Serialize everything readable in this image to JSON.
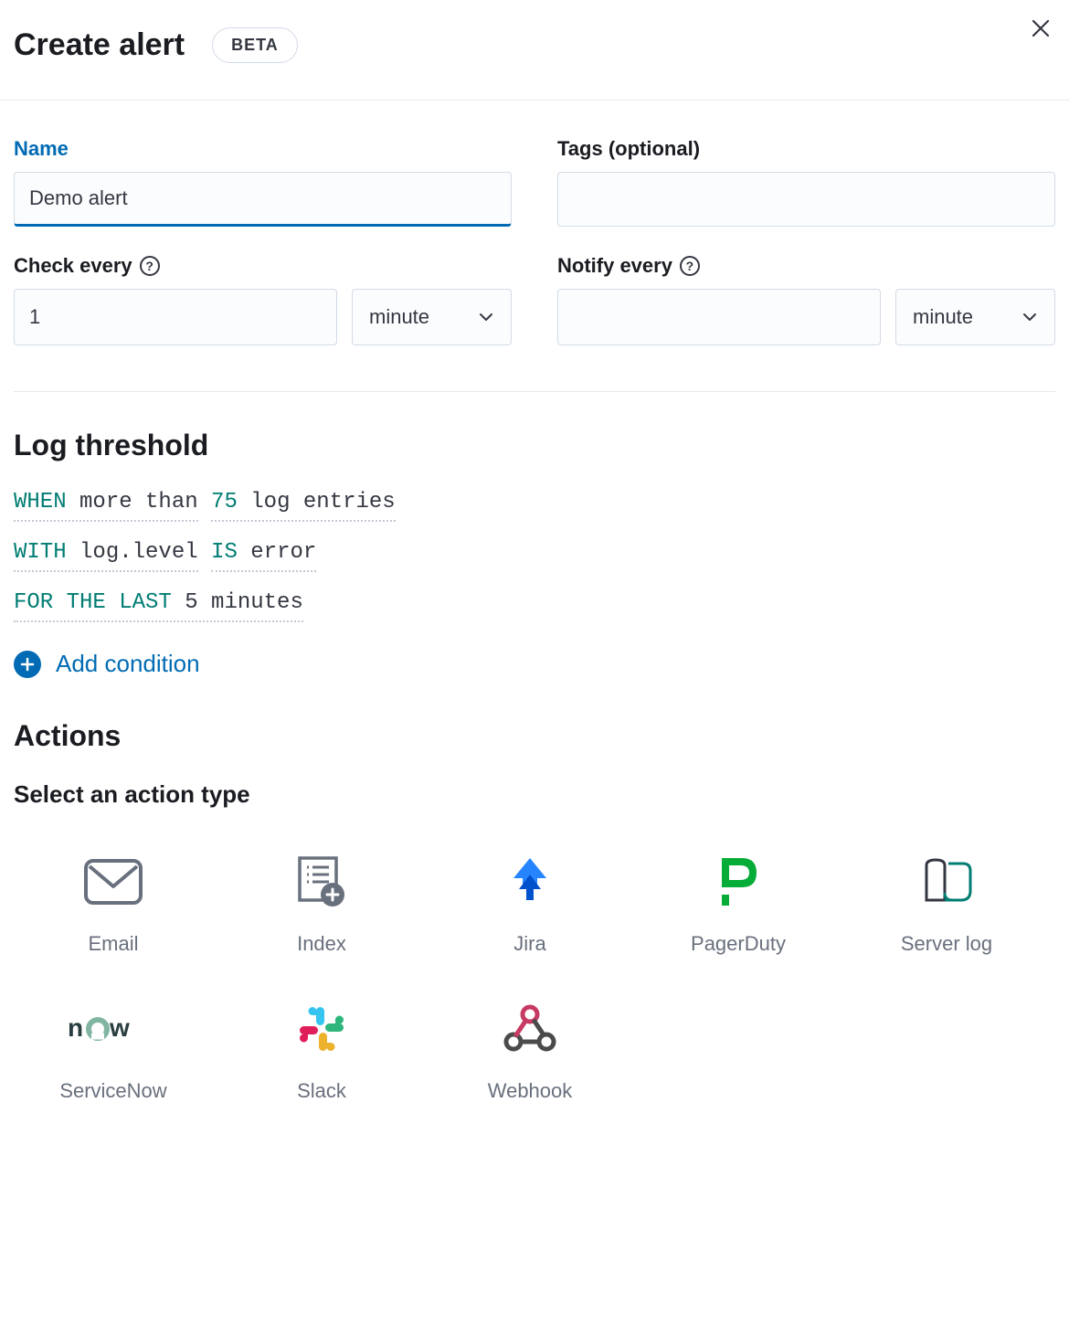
{
  "header": {
    "title": "Create alert",
    "badge": "BETA"
  },
  "form": {
    "name": {
      "label": "Name",
      "value": "Demo alert"
    },
    "tags": {
      "label": "Tags (optional)",
      "value": ""
    },
    "checkEvery": {
      "label": "Check every",
      "value": "1",
      "unit": "minute"
    },
    "notifyEvery": {
      "label": "Notify every",
      "value": "",
      "unit": "minute"
    }
  },
  "threshold": {
    "title": "Log threshold",
    "line1": {
      "keyword": "WHEN",
      "text1": "more than",
      "number": "75",
      "text2": "log entries"
    },
    "line2": {
      "keyword": "WITH",
      "text1": "log.level",
      "keyword2": "IS",
      "text2": "error"
    },
    "line3": {
      "keyword": "FOR THE LAST",
      "text1": "5 minutes"
    },
    "addCondition": "Add condition"
  },
  "actions": {
    "title": "Actions",
    "subtitle": "Select an action type",
    "types": [
      {
        "label": "Email"
      },
      {
        "label": "Index"
      },
      {
        "label": "Jira"
      },
      {
        "label": "PagerDuty"
      },
      {
        "label": "Server log"
      },
      {
        "label": "ServiceNow"
      },
      {
        "label": "Slack"
      },
      {
        "label": "Webhook"
      }
    ]
  }
}
